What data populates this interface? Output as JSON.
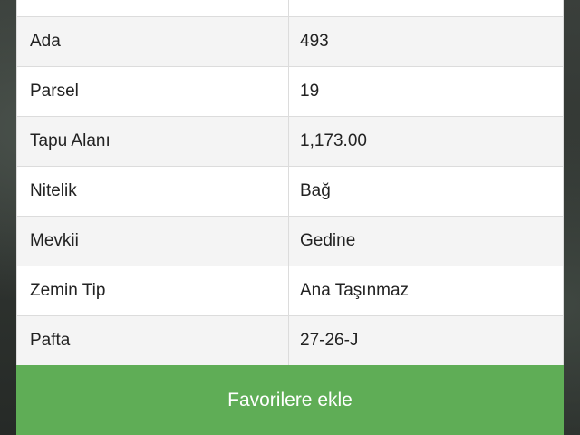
{
  "details": {
    "rows": [
      {
        "label": "",
        "value": ""
      },
      {
        "label": "Ada",
        "value": "493"
      },
      {
        "label": "Parsel",
        "value": "19"
      },
      {
        "label": "Tapu Alanı",
        "value": "1,173.00"
      },
      {
        "label": "Nitelik",
        "value": "Bağ"
      },
      {
        "label": "Mevkii",
        "value": "Gedine"
      },
      {
        "label": "Zemin Tip",
        "value": "Ana Taşınmaz"
      },
      {
        "label": "Pafta",
        "value": "27-26-J"
      }
    ]
  },
  "actions": {
    "favorite_label": "Favorilere ekle"
  },
  "colors": {
    "accent": "#5fad56",
    "row_alt": "#f4f4f4"
  }
}
